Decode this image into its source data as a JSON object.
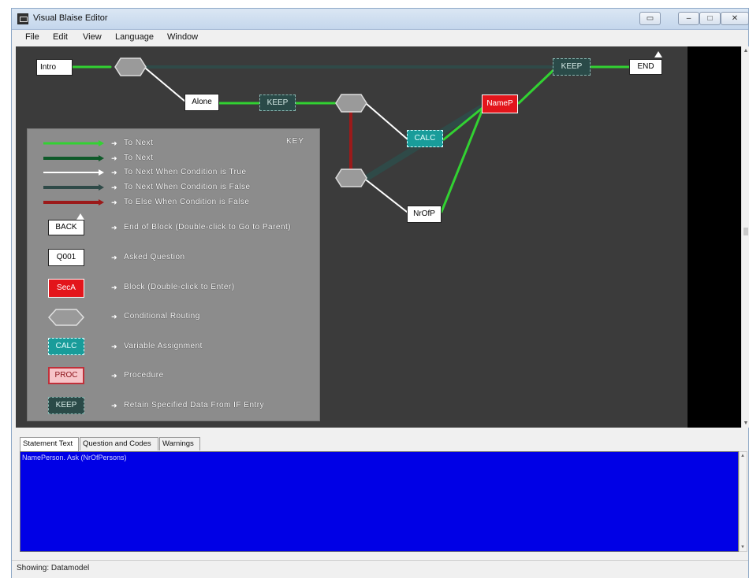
{
  "window": {
    "title": "Visual Blaise Editor"
  },
  "menu": [
    "File",
    "Edit",
    "View",
    "Language",
    "Window"
  ],
  "diagram": {
    "nodes": {
      "intro": "Intro",
      "alone": "Alone",
      "keep1": "KEEP",
      "keep2": "KEEP",
      "end": "END",
      "calc": "CALC",
      "namep": "NameP",
      "nrofp": "NrOfP"
    }
  },
  "key": {
    "title": "KEY",
    "items": [
      {
        "label": "To Next"
      },
      {
        "label": "To Next"
      },
      {
        "label": "To Next When Condition is True"
      },
      {
        "label": "To Next When Condition is False"
      },
      {
        "label": "To Else When Condition is False"
      },
      {
        "sample": "BACK",
        "label": "End of Block (Double-click to Go to Parent)"
      },
      {
        "sample": "Q001",
        "label": "Asked Question"
      },
      {
        "sample": "SecA",
        "label": "Block (Double-click to Enter)"
      },
      {
        "label": "Conditional Routing"
      },
      {
        "sample": "CALC",
        "label": "Variable Assignment"
      },
      {
        "sample": "PROC",
        "label": "Procedure"
      },
      {
        "sample": "KEEP",
        "label": "Retain Specified Data From IF Entry"
      }
    ]
  },
  "tabs": [
    "Statement Text",
    "Question and Codes",
    "Warnings"
  ],
  "statement_text": "NamePerson. Ask (NrOfPersons)",
  "status": "Showing: Datamodel",
  "colors": {
    "canvas": "#3b3b3b",
    "to_next": "#32d232",
    "to_next_dark": "#0f5a2a",
    "true": "#ffffff",
    "false": "#2f4a48",
    "else": "#9b1a1a",
    "statement_bg": "#0000e6"
  }
}
